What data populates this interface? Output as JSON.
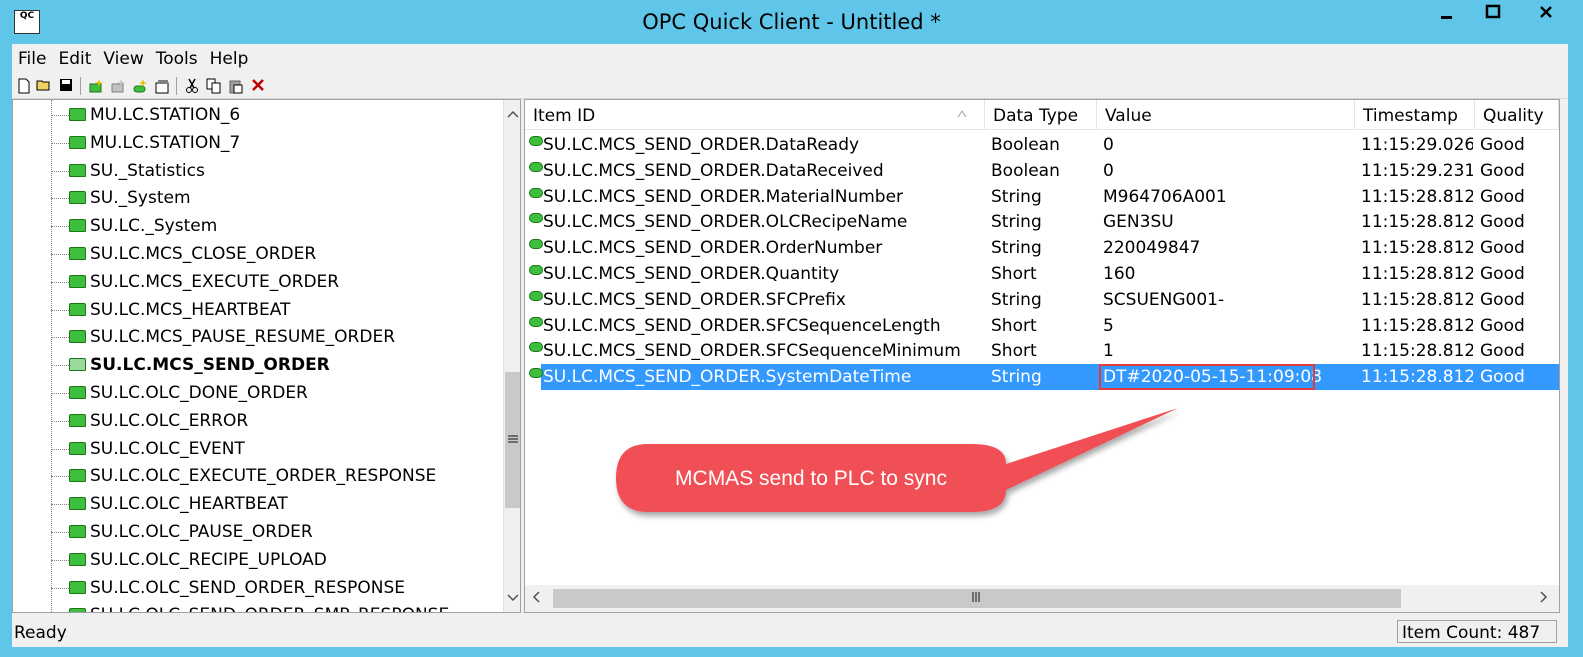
{
  "window": {
    "title": "OPC Quick Client - Untitled *",
    "icon_label": "QC",
    "minimize_icon": "minimize-icon",
    "maximize_icon": "maximize-icon",
    "close_icon": "close-icon"
  },
  "menu": [
    "File",
    "Edit",
    "View",
    "Tools",
    "Help"
  ],
  "toolbar": [
    {
      "name": "new-icon"
    },
    {
      "name": "open-icon"
    },
    {
      "name": "save-icon"
    },
    {
      "name": "new-server-icon"
    },
    {
      "name": "new-group-icon"
    },
    {
      "name": "new-item-icon"
    },
    {
      "name": "properties-icon"
    },
    {
      "name": "cut-icon"
    },
    {
      "name": "copy-icon"
    },
    {
      "name": "paste-icon"
    },
    {
      "name": "delete-icon"
    }
  ],
  "tree": {
    "items": [
      {
        "label": "MU.LC.STATION_6",
        "bold": false
      },
      {
        "label": "MU.LC.STATION_7",
        "bold": false
      },
      {
        "label": "SU._Statistics",
        "bold": false
      },
      {
        "label": "SU._System",
        "bold": false
      },
      {
        "label": "SU.LC._System",
        "bold": false
      },
      {
        "label": "SU.LC.MCS_CLOSE_ORDER",
        "bold": false
      },
      {
        "label": "SU.LC.MCS_EXECUTE_ORDER",
        "bold": false
      },
      {
        "label": "SU.LC.MCS_HEARTBEAT",
        "bold": false
      },
      {
        "label": "SU.LC.MCS_PAUSE_RESUME_ORDER",
        "bold": false
      },
      {
        "label": "SU.LC.MCS_SEND_ORDER",
        "bold": true
      },
      {
        "label": "SU.LC.OLC_DONE_ORDER",
        "bold": false
      },
      {
        "label": "SU.LC.OLC_ERROR",
        "bold": false
      },
      {
        "label": "SU.LC.OLC_EVENT",
        "bold": false
      },
      {
        "label": "SU.LC.OLC_EXECUTE_ORDER_RESPONSE",
        "bold": false
      },
      {
        "label": "SU.LC.OLC_HEARTBEAT",
        "bold": false
      },
      {
        "label": "SU.LC.OLC_PAUSE_ORDER",
        "bold": false
      },
      {
        "label": "SU.LC.OLC_RECIPE_UPLOAD",
        "bold": false
      },
      {
        "label": "SU.LC.OLC_SEND_ORDER_RESPONSE",
        "bold": false
      },
      {
        "label": "SU.LC.OLC_SEND_ORDER_SMP_RESPONSE",
        "bold": false
      }
    ]
  },
  "list": {
    "columns": [
      "Item ID",
      "Data Type",
      "Value",
      "Timestamp",
      "Quality"
    ],
    "rows": [
      {
        "id": "SU.LC.MCS_SEND_ORDER.DataReady",
        "type": "Boolean",
        "value": "0",
        "timestamp": "11:15:29.026",
        "quality": "Good",
        "selected": false
      },
      {
        "id": "SU.LC.MCS_SEND_ORDER.DataReceived",
        "type": "Boolean",
        "value": "0",
        "timestamp": "11:15:29.231",
        "quality": "Good",
        "selected": false
      },
      {
        "id": "SU.LC.MCS_SEND_ORDER.MaterialNumber",
        "type": "String",
        "value": "M964706A001",
        "timestamp": "11:15:28.812",
        "quality": "Good",
        "selected": false
      },
      {
        "id": "SU.LC.MCS_SEND_ORDER.OLCRecipeName",
        "type": "String",
        "value": "GEN3SU",
        "timestamp": "11:15:28.812",
        "quality": "Good",
        "selected": false
      },
      {
        "id": "SU.LC.MCS_SEND_ORDER.OrderNumber",
        "type": "String",
        "value": "220049847",
        "timestamp": "11:15:28.812",
        "quality": "Good",
        "selected": false
      },
      {
        "id": "SU.LC.MCS_SEND_ORDER.Quantity",
        "type": "Short",
        "value": "160",
        "timestamp": "11:15:28.812",
        "quality": "Good",
        "selected": false
      },
      {
        "id": "SU.LC.MCS_SEND_ORDER.SFCPrefix",
        "type": "String",
        "value": "SCSUENG001-",
        "timestamp": "11:15:28.812",
        "quality": "Good",
        "selected": false
      },
      {
        "id": "SU.LC.MCS_SEND_ORDER.SFCSequenceLength",
        "type": "Short",
        "value": "5",
        "timestamp": "11:15:28.812",
        "quality": "Good",
        "selected": false
      },
      {
        "id": "SU.LC.MCS_SEND_ORDER.SFCSequenceMinimum",
        "type": "Short",
        "value": "1",
        "timestamp": "11:15:28.812",
        "quality": "Good",
        "selected": false
      },
      {
        "id": "SU.LC.MCS_SEND_ORDER.SystemDateTime",
        "type": "String",
        "value": "DT#2020-05-15-11:09:08",
        "timestamp": "11:15:28.812",
        "quality": "Good",
        "selected": true
      }
    ]
  },
  "annotation": {
    "text": "MCMAS send to PLC to sync",
    "color": "#f05055",
    "highlight_color": "#e23b3b"
  },
  "status": {
    "text": "Ready",
    "item_count": "Item Count: 487"
  },
  "colors": {
    "titlebar": "#5fc6ea",
    "selection": "#3399ff",
    "folder": "#3dbf3d"
  }
}
